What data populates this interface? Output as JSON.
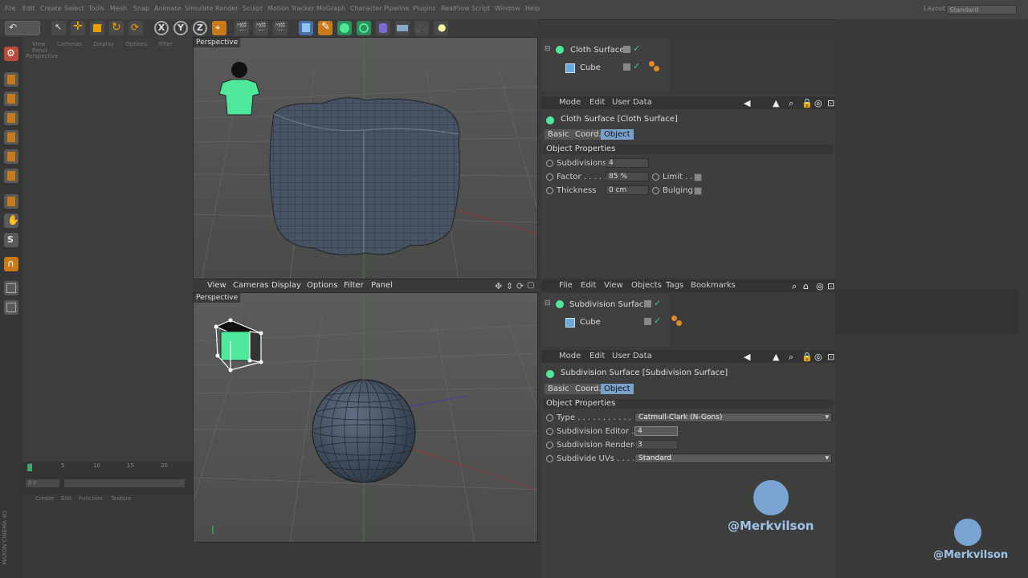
{
  "menubar": {
    "items": [
      "File",
      "Edit",
      "Create",
      "Select",
      "Tools",
      "Mesh",
      "Snap",
      "Animate",
      "Simulate",
      "Render",
      "Sculpt",
      "Motion Tracker",
      "MoGraph",
      "Character",
      "Pipeline",
      "Plugins",
      "RealFlow",
      "Script",
      "Window",
      "Help"
    ],
    "layout_label": "Layout:",
    "layout_value": "Standard"
  },
  "bg_viewport": {
    "menu": [
      "View",
      "Cameras",
      "Display",
      "Options",
      "Filter",
      "Panel"
    ],
    "label": "Perspective"
  },
  "viewport_top": {
    "label": "Perspective"
  },
  "viewport_bottom": {
    "menu": [
      "View",
      "Cameras",
      "Display",
      "Options",
      "Filter",
      "Panel"
    ],
    "label": "Perspective"
  },
  "timeline": {
    "ticks": [
      "0",
      "5",
      "10",
      "15",
      "20"
    ],
    "frame": "0 F"
  },
  "attr_bg_menu": [
    "Create",
    "Edit",
    "Function",
    "Texture"
  ],
  "object_manager_top": {
    "items": [
      {
        "label": "Cloth Surface",
        "icon": "cloth-surface-icon"
      },
      {
        "label": "Cube",
        "icon": "cube-icon"
      }
    ]
  },
  "attr_top": {
    "menu": [
      "Mode",
      "Edit",
      "User Data"
    ],
    "title": "Cloth Surface [Cloth Surface]",
    "tabs": [
      "Basic",
      "Coord.",
      "Object"
    ],
    "active_tab": "Object",
    "section": "Object Properties",
    "props": {
      "subdivisions_label": "Subdivisions",
      "subdivisions_value": "4",
      "factor_label": "Factor . . . . .",
      "factor_value": "85 %",
      "limit_label": "Limit . . .",
      "thickness_label": "Thickness",
      "thickness_value": "0 cm",
      "bulging_label": "Bulging"
    }
  },
  "object_manager_bottom": {
    "menu": [
      "File",
      "Edit",
      "View",
      "Objects",
      "Tags",
      "Bookmarks"
    ],
    "items": [
      {
        "label": "Subdivision Surface",
        "icon": "subdivision-surface-icon"
      },
      {
        "label": "Cube",
        "icon": "cube-icon"
      }
    ]
  },
  "attr_bottom": {
    "menu": [
      "Mode",
      "Edit",
      "User Data"
    ],
    "title": "Subdivision Surface [Subdivision Surface]",
    "tabs": [
      "Basic",
      "Coord.",
      "Object"
    ],
    "active_tab": "Object",
    "section": "Object Properties",
    "props": {
      "type_label": "Type . . . . . . . . . . . . . .",
      "type_value": "Catmull-Clark (N-Gons)",
      "sub_editor_label": "Subdivision Editor . . .",
      "sub_editor_value": "4",
      "sub_renderer_label": "Subdivision Renderer",
      "sub_renderer_value": "3",
      "subdivide_uvs_label": "Subdivide UVs . . . . . .",
      "subdivide_uvs_value": "Standard"
    }
  },
  "watermark": {
    "text1": "@Merkvilson",
    "text2": "@Merkvilson"
  },
  "brand": "MAXON CINEMA 4D",
  "colors": {
    "accent": "#7aa0cc",
    "cloth_green": "#4fe89a",
    "watermark": "#9fc3e8"
  }
}
